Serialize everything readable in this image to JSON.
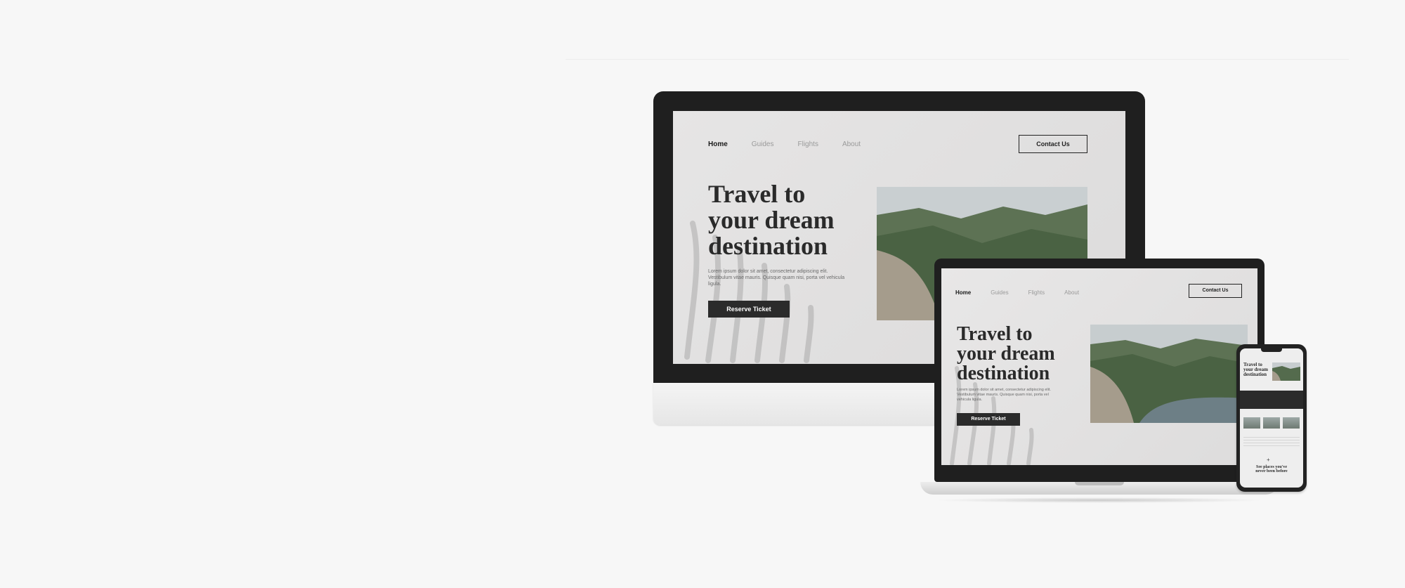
{
  "site": {
    "nav": [
      "Home",
      "Guides",
      "Flights",
      "About"
    ],
    "contact_label": "Contact Us",
    "headline": [
      "Travel to",
      "your dream",
      "destination"
    ],
    "lorem": "Lorem ipsum dolor sit amet, consectetur adipiscing elit. Vestibulum vitae mauris. Quisque quam nisi, porta vel vehicula ligula.",
    "reserve_label": "Reserve Ticket"
  },
  "phone": {
    "headline": [
      "Travel to",
      "your dream",
      "destination"
    ],
    "plus": "+",
    "footer": [
      "See places you've",
      "never been before"
    ]
  },
  "colors": {
    "background": "#f7f7f7",
    "device_bezel": "#1f1f1f",
    "screen": "#e4e3e3",
    "button": "#2b2b2b"
  }
}
